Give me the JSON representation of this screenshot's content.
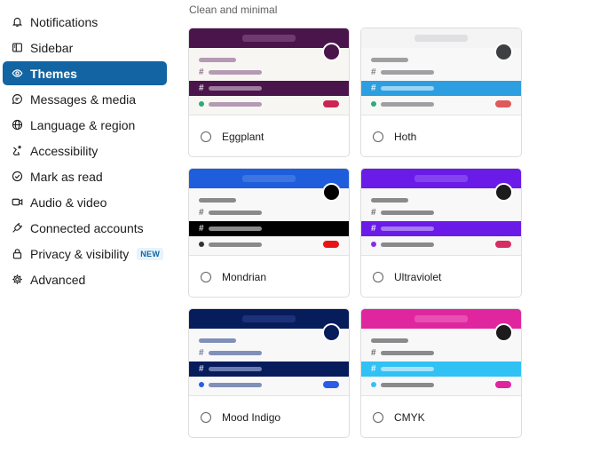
{
  "sidebar": {
    "items": [
      {
        "label": "Notifications",
        "icon": "bell-icon"
      },
      {
        "label": "Sidebar",
        "icon": "sidebar-icon"
      },
      {
        "label": "Themes",
        "icon": "eye-icon",
        "active": true
      },
      {
        "label": "Messages & media",
        "icon": "message-icon"
      },
      {
        "label": "Language & region",
        "icon": "globe-icon"
      },
      {
        "label": "Accessibility",
        "icon": "accessibility-icon"
      },
      {
        "label": "Mark as read",
        "icon": "check-circle-icon"
      },
      {
        "label": "Audio & video",
        "icon": "video-icon"
      },
      {
        "label": "Connected accounts",
        "icon": "plug-icon"
      },
      {
        "label": "Privacy & visibility",
        "icon": "lock-icon",
        "badge": "NEW"
      },
      {
        "label": "Advanced",
        "icon": "gear-icon"
      }
    ]
  },
  "main": {
    "section_title": "Clean and minimal",
    "themes": [
      {
        "name": "Eggplant",
        "colors": {
          "top": "#4a154b",
          "search": "#6e3a6f",
          "avatar": "#4a154b",
          "body": "#f8f6f3",
          "bar": "#b49ab3",
          "hash": "#8a6c8a",
          "active_bg": "#4a154b",
          "active_bar": "#9f7c9f",
          "active_hash": "#e8dbe8",
          "dot": "#2bac76",
          "pill": "#cd2553"
        }
      },
      {
        "name": "Hoth",
        "colors": {
          "top": "#f4f4f5",
          "search": "#e0e0e2",
          "avatar": "#3d3f43",
          "body": "#f8f8f8",
          "bar": "#a0a0a2",
          "hash": "#7e7e80",
          "active_bg": "#2d9ee0",
          "active_bar": "#9bd4f4",
          "active_hash": "#e6f5fd",
          "dot": "#2bac76",
          "pill": "#e05a5a"
        }
      },
      {
        "name": "Mondrian",
        "colors": {
          "top": "#1e5ddb",
          "search": "#3c75e2",
          "avatar": "#000000",
          "body": "#f8f8f8",
          "bar": "#8a8a8c",
          "hash": "#6a6a6c",
          "active_bg": "#000000",
          "active_bar": "#8a8a8c",
          "active_hash": "#d8d8d8",
          "dot": "#333333",
          "pill": "#e81414"
        }
      },
      {
        "name": "Ultraviolet",
        "colors": {
          "top": "#6a1be8",
          "search": "#8443ee",
          "avatar": "#1d1c1d",
          "body": "#f8f8f8",
          "bar": "#8a8a8c",
          "hash": "#6a6a6c",
          "active_bg": "#6a1be8",
          "active_bar": "#a57af2",
          "active_hash": "#ece0fc",
          "dot": "#8a2be8",
          "pill": "#d62d63"
        }
      },
      {
        "name": "Mood Indigo",
        "colors": {
          "top": "#071c5b",
          "search": "#1b3278",
          "avatar": "#071c5b",
          "body": "#f8f8f8",
          "bar": "#8090b8",
          "hash": "#6a7aa0",
          "active_bg": "#071c5b",
          "active_bar": "#6b7db0",
          "active_hash": "#d0d8ee",
          "dot": "#2a5ce8",
          "pill": "#2a5ce8"
        }
      },
      {
        "name": "CMYK",
        "colors": {
          "top": "#e0269e",
          "search": "#e84fb3",
          "avatar": "#1d1c1d",
          "body": "#f8f8f8",
          "bar": "#8a8a8c",
          "hash": "#6a6a6c",
          "active_bg": "#30c1f5",
          "active_bar": "#a6e3fa",
          "active_hash": "#e6f8fe",
          "dot": "#30c1f5",
          "pill": "#e0269e"
        }
      }
    ]
  }
}
